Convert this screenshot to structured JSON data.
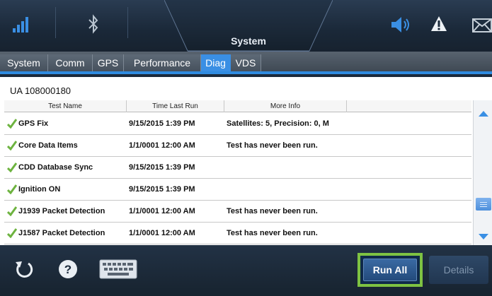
{
  "header": {
    "title": "System",
    "icons": [
      "signal-icon",
      "bluetooth-icon",
      "speaker-icon",
      "warning-icon",
      "mail-icon"
    ]
  },
  "tabs": [
    {
      "label": "System",
      "active": false
    },
    {
      "label": "Comm",
      "active": false
    },
    {
      "label": "GPS",
      "active": false
    },
    {
      "label": "Performance",
      "active": false
    },
    {
      "label": "Diag",
      "active": true
    },
    {
      "label": "VDS",
      "active": false
    }
  ],
  "diag": {
    "unit_id": "UA 108000180",
    "columns": [
      "Test Name",
      "Time Last Run",
      "More Info"
    ],
    "rows": [
      {
        "name": "GPS Fix",
        "time": "9/15/2015 1:39 PM",
        "info": "Satellites: 5, Precision: 0, M",
        "status": "pass"
      },
      {
        "name": "Core Data Items",
        "time": "1/1/0001 12:00 AM",
        "info": "Test has never been run.",
        "status": "pass"
      },
      {
        "name": "CDD Database Sync",
        "time": "9/15/2015 1:39 PM",
        "info": "",
        "status": "pass"
      },
      {
        "name": "Ignition ON",
        "time": "9/15/2015 1:39 PM",
        "info": "",
        "status": "pass"
      },
      {
        "name": "J1939 Packet Detection",
        "time": "1/1/0001 12:00 AM",
        "info": "Test has never been run.",
        "status": "pass"
      },
      {
        "name": "J1587 Packet Detection",
        "time": "1/1/0001 12:00 AM",
        "info": "Test has never been run.",
        "status": "pass"
      }
    ]
  },
  "toolbar": {
    "run_all_label": "Run All",
    "details_label": "Details",
    "icons": [
      "refresh-icon",
      "help-icon",
      "keyboard-icon"
    ]
  },
  "colors": {
    "accent": "#3a8fe4",
    "check": "#6db33f",
    "highlight": "#7ec242"
  }
}
